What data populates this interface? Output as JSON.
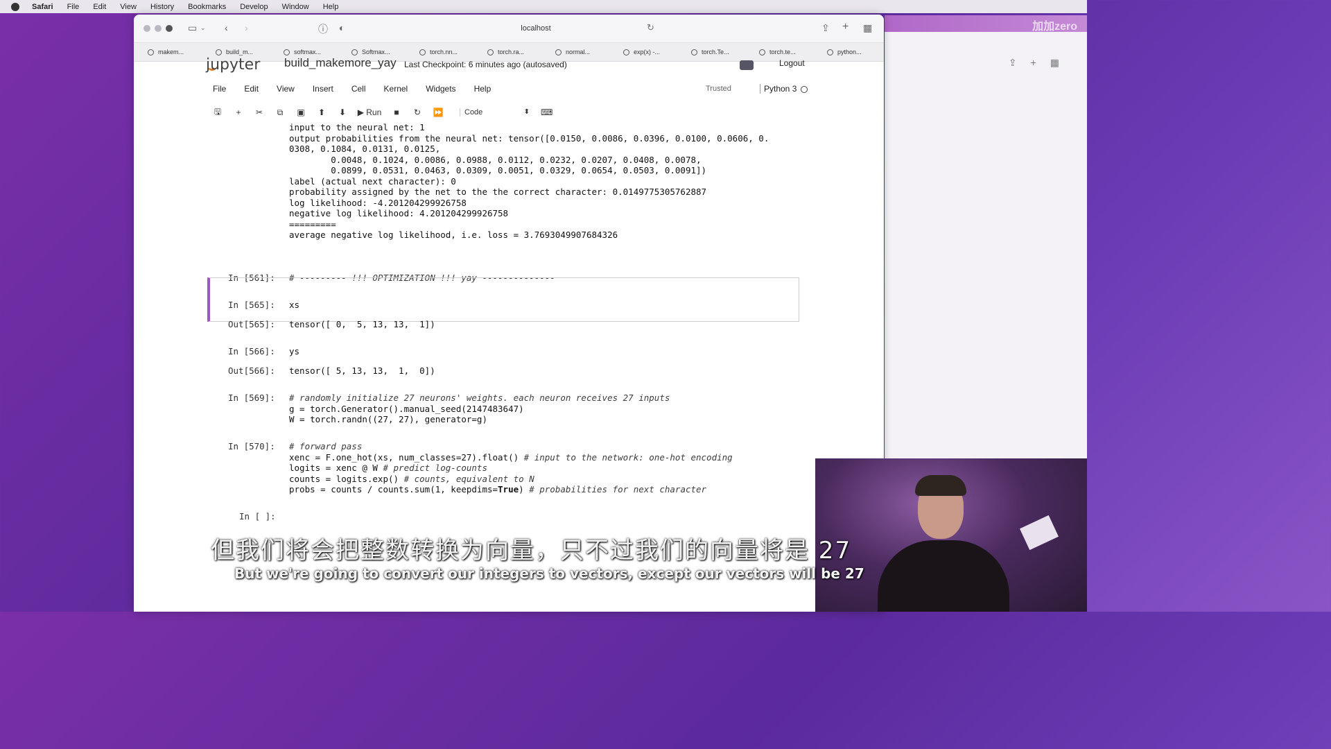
{
  "menubar": {
    "items": [
      "Safari",
      "File",
      "Edit",
      "View",
      "History",
      "Bookmarks",
      "Develop",
      "Window",
      "Help"
    ]
  },
  "browser": {
    "url": "localhost",
    "tabs": [
      "makem...",
      "build_m...",
      "softmax...",
      "Softmax...",
      "torch.nn...",
      "torch.ra...",
      "normal...",
      "exp(x) -...",
      "torch.Te...",
      "torch.te...",
      "python..."
    ]
  },
  "background_window": {
    "title": "加加zero"
  },
  "jupyter": {
    "logo": "jupyter",
    "notebook_title": "build_makemore_yay",
    "checkpoint": "Last Checkpoint: 6 minutes ago",
    "autosaved": "(autosaved)",
    "logout": "Logout",
    "menu": [
      "File",
      "Edit",
      "View",
      "Insert",
      "Cell",
      "Kernel",
      "Widgets",
      "Help"
    ],
    "trusted": "Trusted",
    "kernel": "Python 3",
    "toolbar": {
      "run_label": "Run",
      "cell_type": "Code"
    }
  },
  "notebook": {
    "output_lines": [
      "input to the neural net: 1",
      "output probabilities from the neural net: tensor([0.0150, 0.0086, 0.0396, 0.0100, 0.0606, 0.",
      "0308, 0.1084, 0.0131, 0.0125,",
      "        0.0048, 0.1024, 0.0086, 0.0988, 0.0112, 0.0232, 0.0207, 0.0408, 0.0078,",
      "        0.0899, 0.0531, 0.0463, 0.0309, 0.0051, 0.0329, 0.0654, 0.0503, 0.0091])",
      "label (actual next character): 0",
      "probability assigned by the net to the the correct character: 0.0149775305762887",
      "log likelihood: -4.201204299926758",
      "negative log likelihood: 4.201204299926758",
      "=========",
      "average negative log likelihood, i.e. loss = 3.7693049907684326"
    ],
    "cells": [
      {
        "prompt": "In [561]:",
        "code": "# --------- !!! OPTIMIZATION !!! yay --------------"
      },
      {
        "prompt": "In [565]:",
        "code": "xs",
        "out_prompt": "Out[565]:",
        "output": "tensor([ 0,  5, 13, 13,  1])"
      },
      {
        "prompt": "In [566]:",
        "code": "ys",
        "out_prompt": "Out[566]:",
        "output": "tensor([ 5, 13, 13,  1,  0])"
      },
      {
        "prompt": "In [569]:",
        "comment": "# randomly initialize 27 neurons' weights. each neuron receives 27 inputs",
        "line2": "g = torch.Generator().manual_seed(2147483647)",
        "line3": "W = torch.randn((27, 27), generator=g)"
      },
      {
        "prompt": "In [570]:",
        "comment": "# forward pass",
        "l1_code": "xenc = F.one_hot(xs, num_classes=27).float() ",
        "l1_comment": "# input to the network: one-hot encoding",
        "l2_code": "logits = xenc @ W ",
        "l2_comment": "# predict log-counts",
        "l3_code": "counts = logits.exp() ",
        "l3_comment": "# counts, equivalent to N",
        "l4_code": "probs = counts / counts.sum(1, keepdims=",
        "l4_kw": "True",
        "l4_code2": ") ",
        "l4_comment": "# probabilities for next character"
      },
      {
        "prompt": "In [ ]:"
      }
    ]
  },
  "subtitles": {
    "zh": "但我们将会把整数转换为向量，只不过我们的向量将是 27",
    "en": "But we're going to convert our integers to vectors, except our vectors will be 27"
  }
}
